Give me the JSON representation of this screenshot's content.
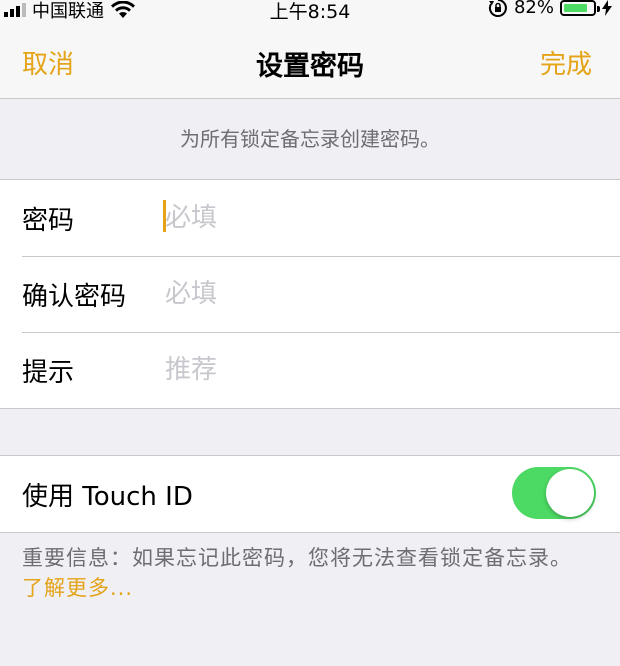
{
  "status_bar": {
    "carrier": "中国联通",
    "time": "上午8:54",
    "battery_percent": "82%",
    "battery_level": 0.82,
    "icons": [
      "signal-icon",
      "wifi-icon",
      "rotation-lock-icon",
      "battery-icon",
      "charging-icon"
    ]
  },
  "nav": {
    "cancel_label": "取消",
    "title": "设置密码",
    "done_label": "完成"
  },
  "section_header": "为所有锁定备忘录创建密码。",
  "form": {
    "rows": [
      {
        "label": "密码",
        "placeholder": "必填",
        "value": ""
      },
      {
        "label": "确认密码",
        "placeholder": "必填",
        "value": ""
      },
      {
        "label": "提示",
        "placeholder": "推荐",
        "value": ""
      }
    ]
  },
  "touch_id": {
    "label": "使用 Touch ID",
    "enabled": true
  },
  "footer": {
    "note": "重要信息：如果忘记此密码，您将无法查看锁定备忘录。",
    "link": "了解更多..."
  },
  "colors": {
    "accent": "#e5a317",
    "toggle_on": "#4cd964",
    "background": "#efeff4",
    "secondary_text": "#6d6d72",
    "placeholder": "#c7c7cd"
  }
}
